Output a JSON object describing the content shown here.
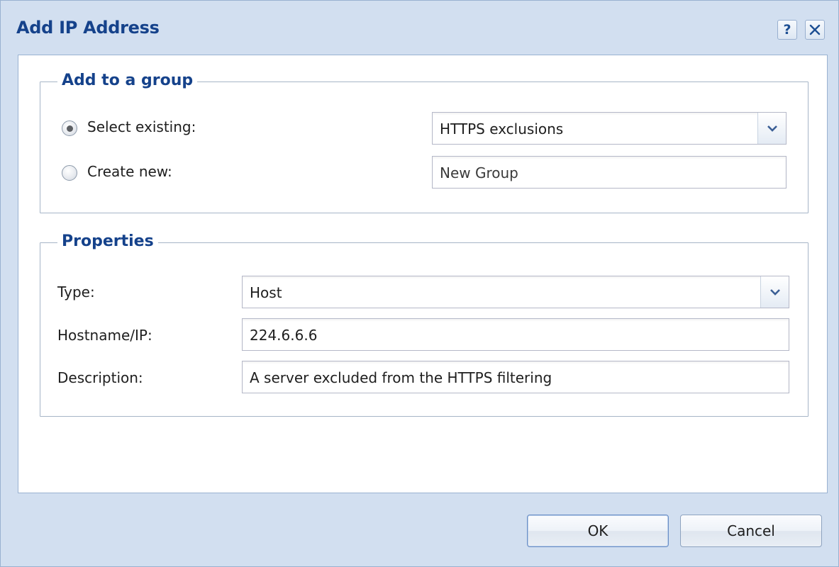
{
  "dialog": {
    "title": "Add IP Address",
    "tools": {
      "help_label": "?",
      "help_icon": "help-icon",
      "close_icon": "close-icon"
    }
  },
  "group_section": {
    "legend": "Add to a group",
    "select_existing": {
      "label": "Select existing:",
      "checked": true,
      "value": "HTTPS exclusions"
    },
    "create_new": {
      "label": "Create new:",
      "checked": false,
      "placeholder": "New Group"
    }
  },
  "properties": {
    "legend": "Properties",
    "type": {
      "label": "Type:",
      "value": "Host"
    },
    "hostname": {
      "label": "Hostname/IP:",
      "value": "224.6.6.6"
    },
    "description": {
      "label": "Description:",
      "value": "A server excluded from the HTTPS filtering"
    }
  },
  "footer": {
    "ok_label": "OK",
    "cancel_label": "Cancel"
  },
  "colors": {
    "title": "#15428b",
    "frame": "#d2dff0",
    "border": "#99b2d1"
  }
}
